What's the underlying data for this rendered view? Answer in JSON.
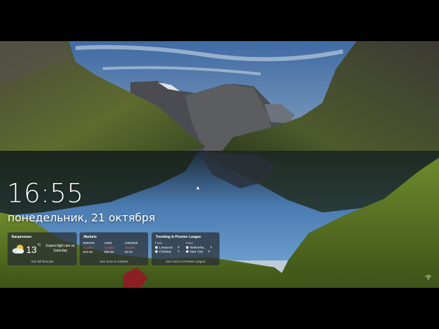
{
  "lock_screen": {
    "time": "16:55",
    "date": "понедельник, 21 октября"
  },
  "widgets": {
    "weather": {
      "title": "Багратионн",
      "temperature": "13",
      "unit": "°C",
      "description": "Expect light rain on Saturday",
      "link": "See full forecast",
      "icon": "partly-cloudy-icon"
    },
    "markets": {
      "title": "Markets",
      "columns": [
        {
          "symbol": "WIDOW",
          "change": "-0.15%",
          "value": "643.46"
        },
        {
          "symbol": "AMXI",
          "change": "-0.15%",
          "value": "592.94"
        },
        {
          "symbol": "USD/INR",
          "change": "-0.03%",
          "value": "84.04"
        }
      ],
      "link": "See more in markets"
    },
    "sports": {
      "title": "Trending in Premier League",
      "match1": {
        "status": "Final",
        "team1": "Liverpool",
        "score1": "2",
        "team2": "Chelsea",
        "score2": "1"
      },
      "match2": {
        "status": "Final",
        "team1": "Wolverha...",
        "score1": "1",
        "team2": "Man City",
        "score2": "2"
      },
      "link": "See more in Premier League"
    }
  },
  "colors": {
    "widget_bg": "#282c32",
    "negative": "#ff6b6b"
  },
  "icons": [
    "partly-cloudy-icon",
    "wifi-icon",
    "cursor-icon"
  ]
}
